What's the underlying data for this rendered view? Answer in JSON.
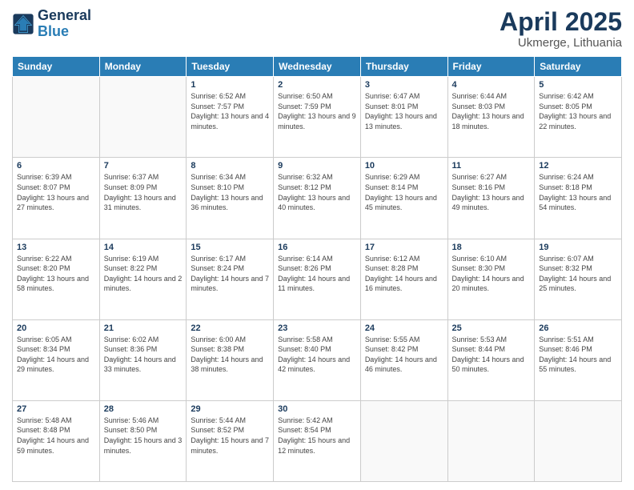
{
  "logo": {
    "line1": "General",
    "line2": "Blue"
  },
  "title": "April 2025",
  "subtitle": "Ukmerge, Lithuania",
  "days_header": [
    "Sunday",
    "Monday",
    "Tuesday",
    "Wednesday",
    "Thursday",
    "Friday",
    "Saturday"
  ],
  "weeks": [
    [
      {
        "day": "",
        "info": ""
      },
      {
        "day": "",
        "info": ""
      },
      {
        "day": "1",
        "info": "Sunrise: 6:52 AM\nSunset: 7:57 PM\nDaylight: 13 hours and 4 minutes."
      },
      {
        "day": "2",
        "info": "Sunrise: 6:50 AM\nSunset: 7:59 PM\nDaylight: 13 hours and 9 minutes."
      },
      {
        "day": "3",
        "info": "Sunrise: 6:47 AM\nSunset: 8:01 PM\nDaylight: 13 hours and 13 minutes."
      },
      {
        "day": "4",
        "info": "Sunrise: 6:44 AM\nSunset: 8:03 PM\nDaylight: 13 hours and 18 minutes."
      },
      {
        "day": "5",
        "info": "Sunrise: 6:42 AM\nSunset: 8:05 PM\nDaylight: 13 hours and 22 minutes."
      }
    ],
    [
      {
        "day": "6",
        "info": "Sunrise: 6:39 AM\nSunset: 8:07 PM\nDaylight: 13 hours and 27 minutes."
      },
      {
        "day": "7",
        "info": "Sunrise: 6:37 AM\nSunset: 8:09 PM\nDaylight: 13 hours and 31 minutes."
      },
      {
        "day": "8",
        "info": "Sunrise: 6:34 AM\nSunset: 8:10 PM\nDaylight: 13 hours and 36 minutes."
      },
      {
        "day": "9",
        "info": "Sunrise: 6:32 AM\nSunset: 8:12 PM\nDaylight: 13 hours and 40 minutes."
      },
      {
        "day": "10",
        "info": "Sunrise: 6:29 AM\nSunset: 8:14 PM\nDaylight: 13 hours and 45 minutes."
      },
      {
        "day": "11",
        "info": "Sunrise: 6:27 AM\nSunset: 8:16 PM\nDaylight: 13 hours and 49 minutes."
      },
      {
        "day": "12",
        "info": "Sunrise: 6:24 AM\nSunset: 8:18 PM\nDaylight: 13 hours and 54 minutes."
      }
    ],
    [
      {
        "day": "13",
        "info": "Sunrise: 6:22 AM\nSunset: 8:20 PM\nDaylight: 13 hours and 58 minutes."
      },
      {
        "day": "14",
        "info": "Sunrise: 6:19 AM\nSunset: 8:22 PM\nDaylight: 14 hours and 2 minutes."
      },
      {
        "day": "15",
        "info": "Sunrise: 6:17 AM\nSunset: 8:24 PM\nDaylight: 14 hours and 7 minutes."
      },
      {
        "day": "16",
        "info": "Sunrise: 6:14 AM\nSunset: 8:26 PM\nDaylight: 14 hours and 11 minutes."
      },
      {
        "day": "17",
        "info": "Sunrise: 6:12 AM\nSunset: 8:28 PM\nDaylight: 14 hours and 16 minutes."
      },
      {
        "day": "18",
        "info": "Sunrise: 6:10 AM\nSunset: 8:30 PM\nDaylight: 14 hours and 20 minutes."
      },
      {
        "day": "19",
        "info": "Sunrise: 6:07 AM\nSunset: 8:32 PM\nDaylight: 14 hours and 25 minutes."
      }
    ],
    [
      {
        "day": "20",
        "info": "Sunrise: 6:05 AM\nSunset: 8:34 PM\nDaylight: 14 hours and 29 minutes."
      },
      {
        "day": "21",
        "info": "Sunrise: 6:02 AM\nSunset: 8:36 PM\nDaylight: 14 hours and 33 minutes."
      },
      {
        "day": "22",
        "info": "Sunrise: 6:00 AM\nSunset: 8:38 PM\nDaylight: 14 hours and 38 minutes."
      },
      {
        "day": "23",
        "info": "Sunrise: 5:58 AM\nSunset: 8:40 PM\nDaylight: 14 hours and 42 minutes."
      },
      {
        "day": "24",
        "info": "Sunrise: 5:55 AM\nSunset: 8:42 PM\nDaylight: 14 hours and 46 minutes."
      },
      {
        "day": "25",
        "info": "Sunrise: 5:53 AM\nSunset: 8:44 PM\nDaylight: 14 hours and 50 minutes."
      },
      {
        "day": "26",
        "info": "Sunrise: 5:51 AM\nSunset: 8:46 PM\nDaylight: 14 hours and 55 minutes."
      }
    ],
    [
      {
        "day": "27",
        "info": "Sunrise: 5:48 AM\nSunset: 8:48 PM\nDaylight: 14 hours and 59 minutes."
      },
      {
        "day": "28",
        "info": "Sunrise: 5:46 AM\nSunset: 8:50 PM\nDaylight: 15 hours and 3 minutes."
      },
      {
        "day": "29",
        "info": "Sunrise: 5:44 AM\nSunset: 8:52 PM\nDaylight: 15 hours and 7 minutes."
      },
      {
        "day": "30",
        "info": "Sunrise: 5:42 AM\nSunset: 8:54 PM\nDaylight: 15 hours and 12 minutes."
      },
      {
        "day": "",
        "info": ""
      },
      {
        "day": "",
        "info": ""
      },
      {
        "day": "",
        "info": ""
      }
    ]
  ]
}
